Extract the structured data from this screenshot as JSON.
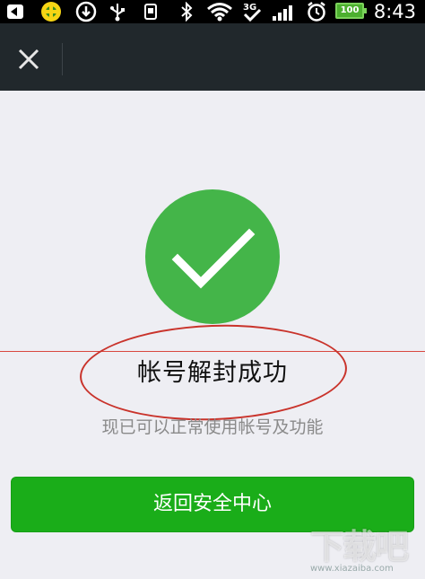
{
  "status_bar": {
    "time": "8:43",
    "battery": "100",
    "network": "3G",
    "icons": [
      "back-arrow-icon",
      "app-icon",
      "download-icon",
      "usb-icon",
      "debug-icon",
      "bluetooth-icon",
      "wifi-icon",
      "network-3g-icon",
      "signal-icon",
      "alarm-icon",
      "battery-icon"
    ]
  },
  "navbar": {
    "close_icon": "close-icon"
  },
  "main": {
    "success_icon": "checkmark-icon",
    "title": "帐号解封成功",
    "subtitle": "现已可以正常使用帐号及功能",
    "button_label": "返回安全中心"
  },
  "colors": {
    "navbar": "#21282c",
    "success_green": "#44b549",
    "button_green": "#1aad19",
    "annotation_red": "#c9332b",
    "background": "#eeeef3"
  },
  "watermark": {
    "logo": "下载吧",
    "url": "www.xiazaiba.com"
  }
}
